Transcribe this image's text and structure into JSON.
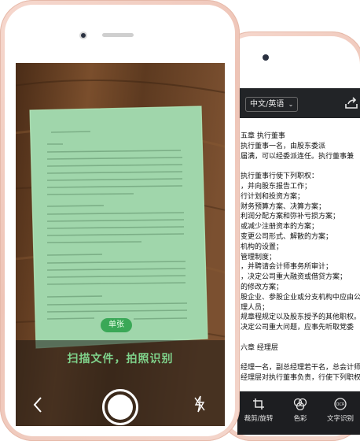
{
  "right_phone": {
    "language_selector": "中文/英语",
    "ocr_lines": [
      "五章  执行董事",
      "执行董事一名，由股东委派",
      "届满，可以经委派连任。执行董事兼",
      "",
      "执行董事行使下列职权：",
      "，并向股东报告工作；",
      "行计划和投资方案；",
      "财务预算方案、决算方案；",
      "利润分配方案和弥补亏损方案；",
      "或减少注册资本的方案；",
      "变更公司形式、解散的方案；",
      "机构的设置；",
      "管理制度；",
      "，并聘请会计师事务所审计；",
      "，决定公司重大融资或借贷方案；",
      "的修改方案；",
      "股企业、参股企业或分支机构中应由公",
      "理人员；",
      "规章程规定以及股东授予的其他职权。",
      "决定公司重大问题，应事先听取党委",
      "",
      "六章  经理层",
      "",
      "经理一名，副总经理若干名，总会计师",
      "经理层对执行董事负责，行使下列职权："
    ],
    "toolbar": [
      {
        "label": "裁剪/旋转",
        "icon": "crop-rotate-icon"
      },
      {
        "label": "色彩",
        "icon": "color-icon"
      },
      {
        "label": "文字识别",
        "icon": "ocr-icon"
      }
    ]
  },
  "left_phone": {
    "mode_label": "单张",
    "scan_hint": "扫描文件，拍照识别",
    "back_icon": "back-chevron-icon",
    "shutter_icon": "shutter-button-icon",
    "flash_icon": "flash-off-icon"
  },
  "colors": {
    "phone_frame": "#f2cfc3",
    "accent_green": "#3aa857",
    "scan_overlay": "#8fd19e",
    "topbar": "#222427"
  }
}
